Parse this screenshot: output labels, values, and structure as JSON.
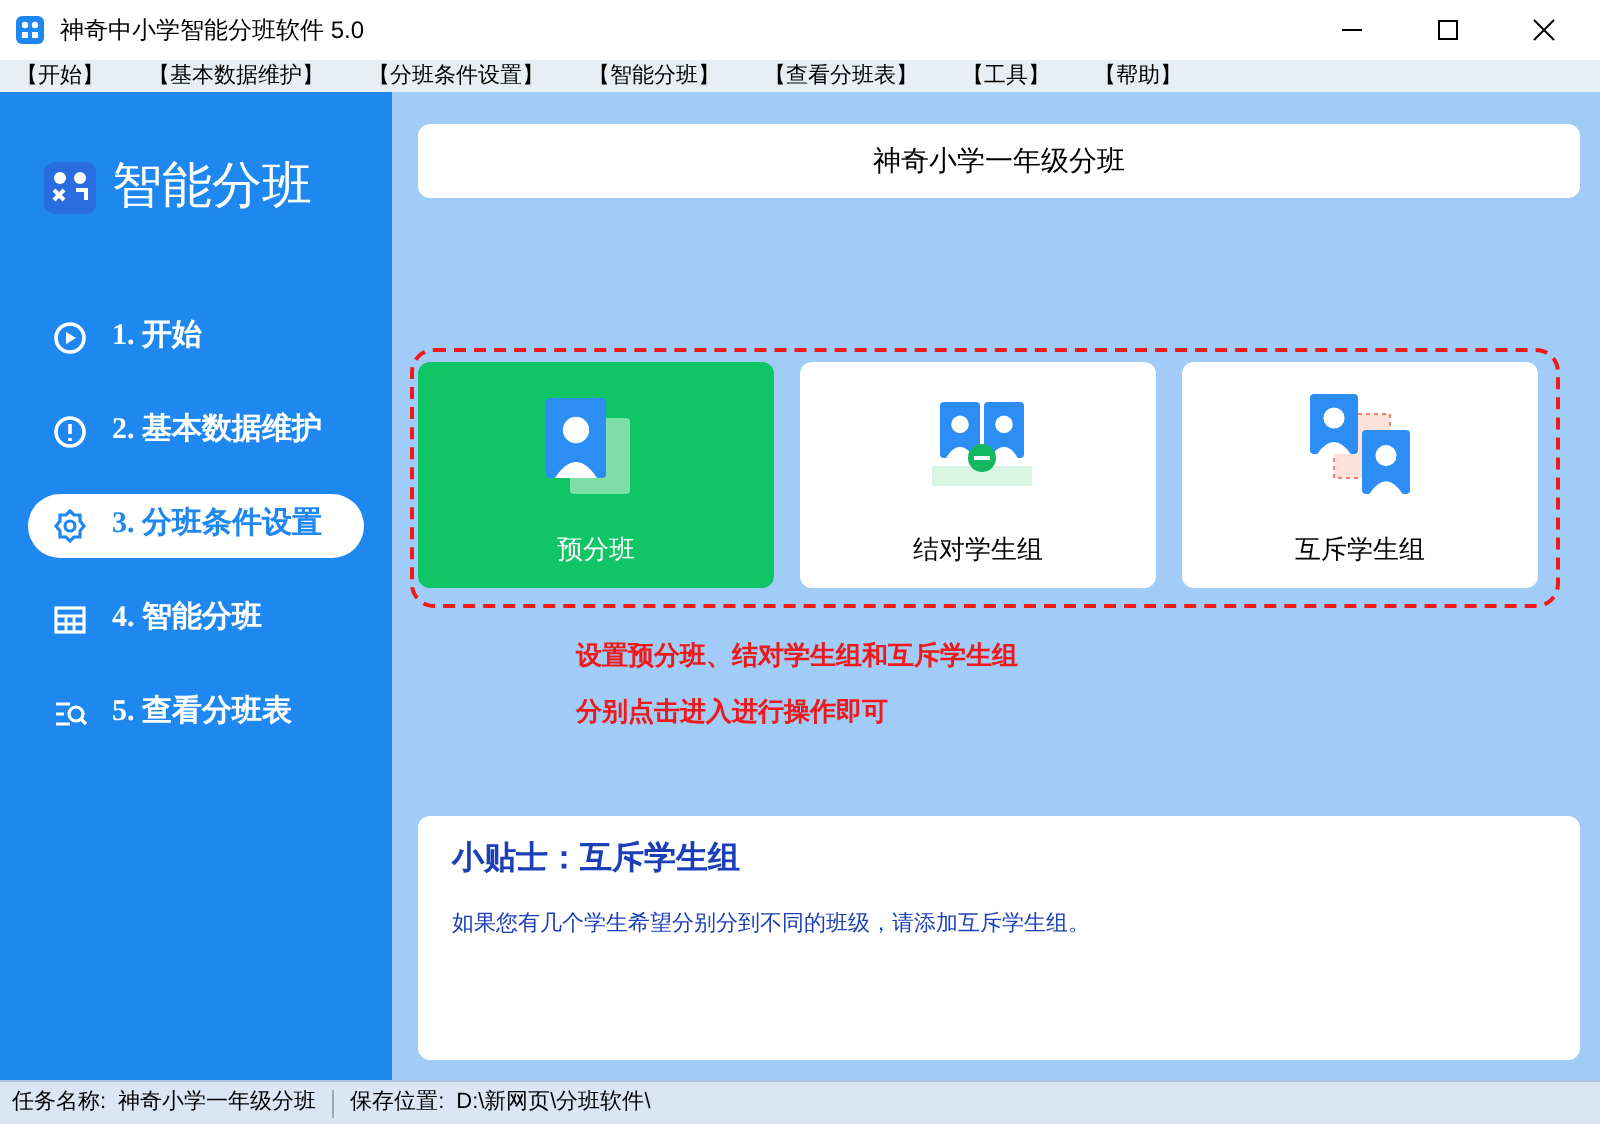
{
  "window": {
    "title": "神奇中小学智能分班软件 5.0"
  },
  "menu": [
    "【开始】",
    "【基本数据维护】",
    "【分班条件设置】",
    "【智能分班】",
    "【查看分班表】",
    "【工具】",
    "【帮助】"
  ],
  "sidebar": {
    "title": "智能分班",
    "items": [
      {
        "label": "1. 开始",
        "kind": "play",
        "selected": false
      },
      {
        "label": "2. 基本数据维护",
        "kind": "info",
        "selected": false
      },
      {
        "label": "3. 分班条件设置",
        "kind": "gear",
        "selected": true
      },
      {
        "label": "4. 智能分班",
        "kind": "table",
        "selected": false
      },
      {
        "label": "5. 查看分班表",
        "kind": "search",
        "selected": false
      }
    ]
  },
  "header": "神奇小学一年级分班",
  "cards": [
    {
      "label": "预分班",
      "kind": "pre",
      "selected": true
    },
    {
      "label": "结对学生组",
      "kind": "pair",
      "selected": false
    },
    {
      "label": "互斥学生组",
      "kind": "exclusive",
      "selected": false
    }
  ],
  "hint_lines": [
    "设置预分班、结对学生组和互斥学生组",
    "分别点击进入进行操作即可"
  ],
  "tip": {
    "title": "小贴士：互斥学生组",
    "text": "如果您有几个学生希望分别分到不同的班级，请添加互斥学生组。"
  },
  "status_bar": {
    "task_label": "任务名称:",
    "task": "神奇小学一年级分班",
    "path_label": "保存位置:",
    "path": "D:\\新网页\\分班软件\\"
  }
}
